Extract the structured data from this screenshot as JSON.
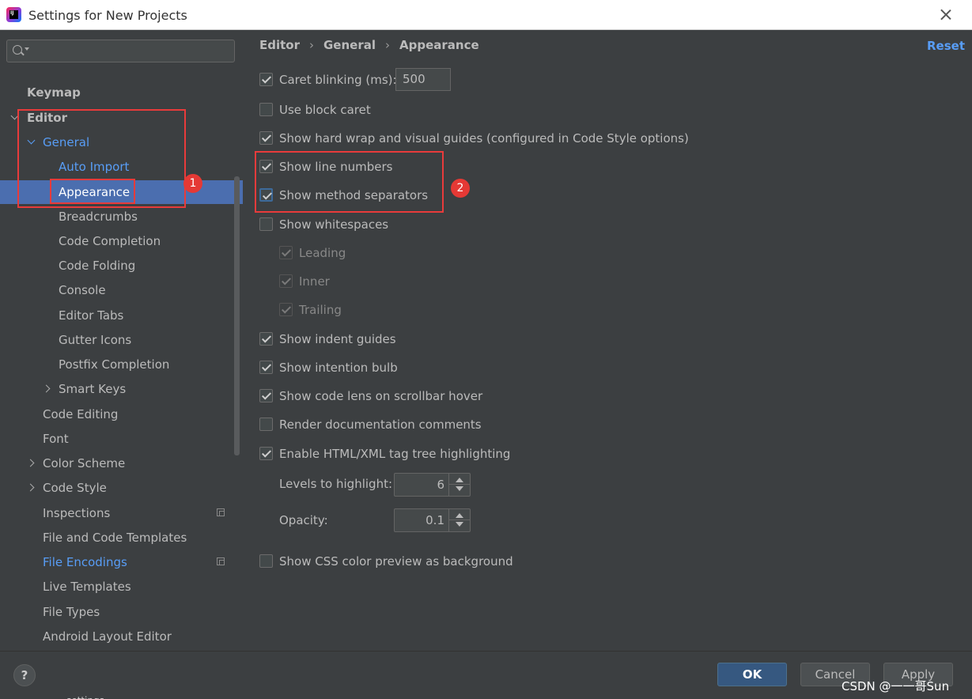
{
  "window": {
    "title": "Settings for New Projects",
    "logo_text": "IJ"
  },
  "search": {
    "placeholder": ""
  },
  "sidebar": {
    "items": [
      {
        "label": "Keymap"
      },
      {
        "label": "Editor"
      },
      {
        "label": "General"
      },
      {
        "label": "Auto Import"
      },
      {
        "label": "Appearance"
      },
      {
        "label": "Breadcrumbs"
      },
      {
        "label": "Code Completion"
      },
      {
        "label": "Code Folding"
      },
      {
        "label": "Console"
      },
      {
        "label": "Editor Tabs"
      },
      {
        "label": "Gutter Icons"
      },
      {
        "label": "Postfix Completion"
      },
      {
        "label": "Smart Keys"
      },
      {
        "label": "Code Editing"
      },
      {
        "label": "Font"
      },
      {
        "label": "Color Scheme"
      },
      {
        "label": "Code Style"
      },
      {
        "label": "Inspections"
      },
      {
        "label": "File and Code Templates"
      },
      {
        "label": "File Encodings"
      },
      {
        "label": "Live Templates"
      },
      {
        "label": "File Types"
      },
      {
        "label": "Android Layout Editor"
      }
    ]
  },
  "annotations": {
    "badge1": "1",
    "badge2": "2"
  },
  "breadcrumb": [
    "Editor",
    "General",
    "Appearance"
  ],
  "reset_label": "Reset",
  "options": {
    "caret_blinking": {
      "label": "Caret blinking (ms):",
      "checked": true,
      "value": "500"
    },
    "block_caret": {
      "label": "Use block caret",
      "checked": false
    },
    "hard_wrap": {
      "label": "Show hard wrap and visual guides (configured in Code Style options)",
      "checked": true
    },
    "line_numbers": {
      "label": "Show line numbers",
      "checked": true
    },
    "method_separators": {
      "label": "Show method separators",
      "checked": true
    },
    "whitespaces": {
      "label": "Show whitespaces",
      "checked": false
    },
    "leading": {
      "label": "Leading",
      "checked": true
    },
    "inner": {
      "label": "Inner",
      "checked": true
    },
    "trailing": {
      "label": "Trailing",
      "checked": true
    },
    "indent_guides": {
      "label": "Show indent guides",
      "checked": true
    },
    "intention_bulb": {
      "label": "Show intention bulb",
      "checked": true
    },
    "code_lens": {
      "label": "Show code lens on scrollbar hover",
      "checked": true
    },
    "render_docs": {
      "label": "Render documentation comments",
      "checked": false
    },
    "tag_tree": {
      "label": "Enable HTML/XML tag tree highlighting",
      "checked": true
    },
    "levels": {
      "label": "Levels to highlight:",
      "value": "6"
    },
    "opacity": {
      "label": "Opacity:",
      "value": "0.1"
    },
    "css_preview": {
      "label": "Show CSS color preview as background",
      "checked": false
    }
  },
  "footer": {
    "help": "?",
    "ok": "OK",
    "cancel": "Cancel",
    "apply": "Apply",
    "watermark": "CSDN @一一哥Sun",
    "taskbar_peek": "settings"
  },
  "colors": {
    "selection": "#4b6eaf",
    "link": "#589df6",
    "annotation": "#e83b3b",
    "ok_button": "#365880"
  }
}
